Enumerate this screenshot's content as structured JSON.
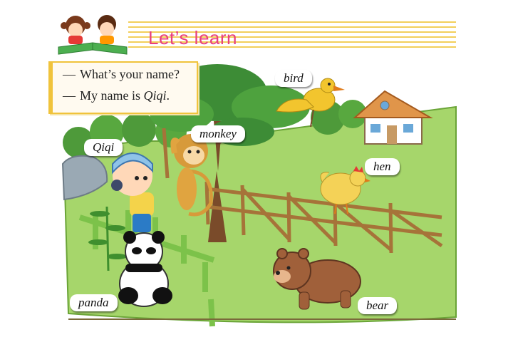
{
  "header": {
    "title": "Let’s learn"
  },
  "dialog": {
    "line1": "What’s your name?",
    "line2_prefix": "My name is ",
    "line2_name": "Qiqi",
    "line2_suffix": "."
  },
  "labels": {
    "bird": "bird",
    "monkey": "monkey",
    "qiqi": "Qiqi",
    "hen": "hen",
    "panda": "panda",
    "bear": "bear"
  },
  "colors": {
    "title": "#e8407e",
    "stripe": "#f2cf5b",
    "dialog_border": "#f0c33c",
    "grass": "#a6d66b"
  }
}
